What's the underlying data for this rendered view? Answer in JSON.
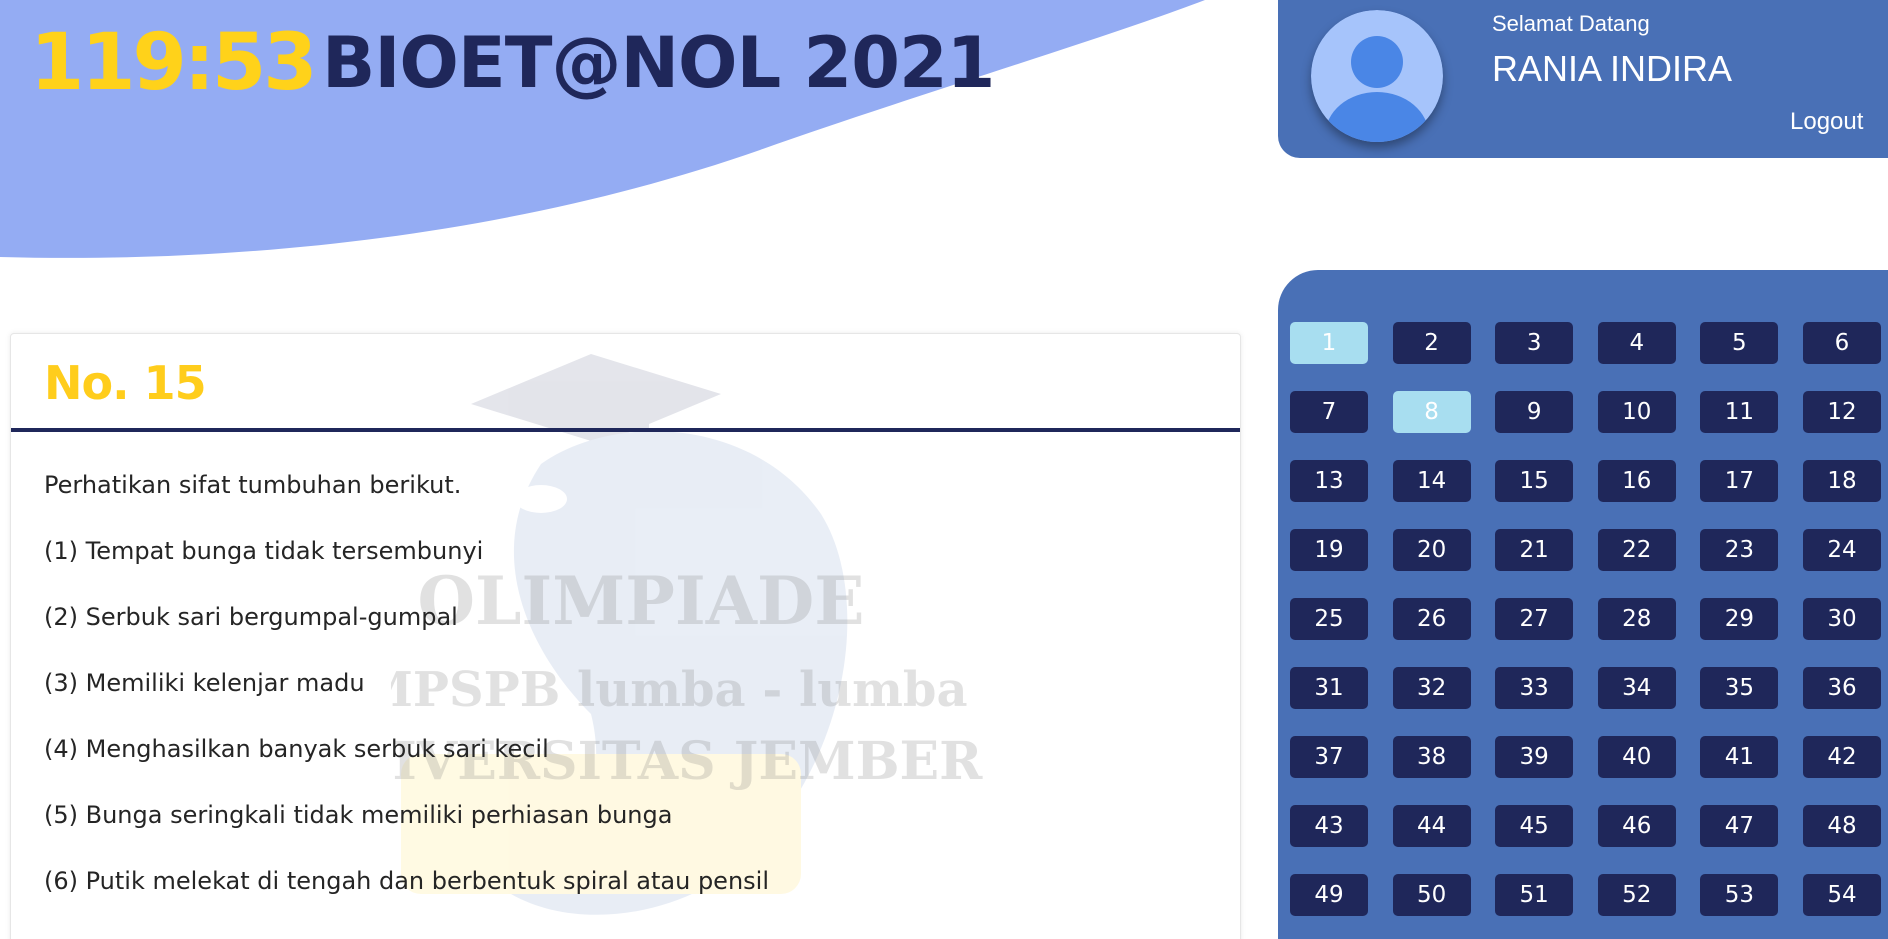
{
  "header": {
    "timer": "119:53",
    "brand_title": "BIOET@NOL 2021"
  },
  "user": {
    "greeting": "Selamat Datang",
    "name": "RANIA INDIRA",
    "logout_label": "Logout"
  },
  "question": {
    "number_label": "No. 15",
    "lines": [
      "Perhatikan sifat tumbuhan berikut.",
      "(1) Tempat bunga tidak tersembunyi",
      "(2) Serbuk sari bergumpal-gumpal",
      "(3) Memiliki kelenjar madu",
      "(4) Menghasilkan banyak serbuk sari kecil",
      "(5) Bunga seringkali tidak memiliki perhiasan bunga",
      "(6) Putik melekat di tengah dan berbentuk spiral atau pensil"
    ]
  },
  "watermark": {
    "line1": "OLIMPIADE",
    "line2": "HMPSPB lumba - lumba",
    "line3": "UNIVERSITAS JEMBER"
  },
  "navigation": {
    "buttons": [
      {
        "label": "1",
        "answered": true
      },
      {
        "label": "2",
        "answered": false
      },
      {
        "label": "3",
        "answered": false
      },
      {
        "label": "4",
        "answered": false
      },
      {
        "label": "5",
        "answered": false
      },
      {
        "label": "6",
        "answered": false
      },
      {
        "label": "7",
        "answered": false
      },
      {
        "label": "8",
        "answered": true
      },
      {
        "label": "9",
        "answered": false
      },
      {
        "label": "10",
        "answered": false
      },
      {
        "label": "11",
        "answered": false
      },
      {
        "label": "12",
        "answered": false
      },
      {
        "label": "13",
        "answered": false
      },
      {
        "label": "14",
        "answered": false
      },
      {
        "label": "15",
        "answered": false
      },
      {
        "label": "16",
        "answered": false
      },
      {
        "label": "17",
        "answered": false
      },
      {
        "label": "18",
        "answered": false
      },
      {
        "label": "19",
        "answered": false
      },
      {
        "label": "20",
        "answered": false
      },
      {
        "label": "21",
        "answered": false
      },
      {
        "label": "22",
        "answered": false
      },
      {
        "label": "23",
        "answered": false
      },
      {
        "label": "24",
        "answered": false
      },
      {
        "label": "25",
        "answered": false
      },
      {
        "label": "26",
        "answered": false
      },
      {
        "label": "27",
        "answered": false
      },
      {
        "label": "28",
        "answered": false
      },
      {
        "label": "29",
        "answered": false
      },
      {
        "label": "30",
        "answered": false
      },
      {
        "label": "31",
        "answered": false
      },
      {
        "label": "32",
        "answered": false
      },
      {
        "label": "33",
        "answered": false
      },
      {
        "label": "34",
        "answered": false
      },
      {
        "label": "35",
        "answered": false
      },
      {
        "label": "36",
        "answered": false
      },
      {
        "label": "37",
        "answered": false
      },
      {
        "label": "38",
        "answered": false
      },
      {
        "label": "39",
        "answered": false
      },
      {
        "label": "40",
        "answered": false
      },
      {
        "label": "41",
        "answered": false
      },
      {
        "label": "42",
        "answered": false
      },
      {
        "label": "43",
        "answered": false
      },
      {
        "label": "44",
        "answered": false
      },
      {
        "label": "45",
        "answered": false
      },
      {
        "label": "46",
        "answered": false
      },
      {
        "label": "47",
        "answered": false
      },
      {
        "label": "48",
        "answered": false
      },
      {
        "label": "49",
        "answered": false
      },
      {
        "label": "50",
        "answered": false
      },
      {
        "label": "51",
        "answered": false
      },
      {
        "label": "52",
        "answered": false
      },
      {
        "label": "53",
        "answered": false
      },
      {
        "label": "54",
        "answered": false
      }
    ]
  },
  "colors": {
    "header_wave": "#94acf3",
    "panel_blue": "#4970b6",
    "nav_button": "#1f275a",
    "nav_button_answered": "#a8def0",
    "accent_yellow": "#ffd21a",
    "brand_navy": "#1f275a"
  }
}
